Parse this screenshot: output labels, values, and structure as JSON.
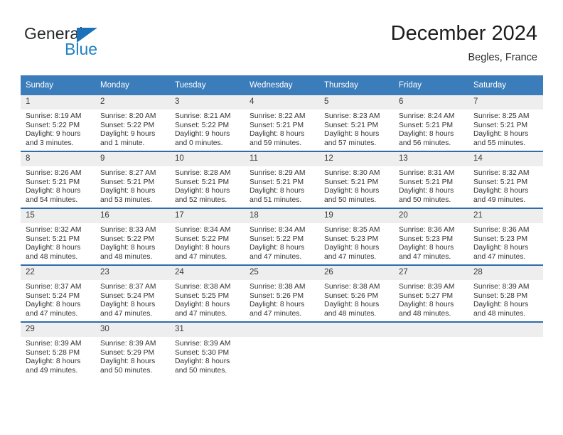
{
  "brand": {
    "name_part1": "General",
    "name_part2": "Blue",
    "triangle_color": "#1b72b8",
    "blue_color": "#2081c3"
  },
  "header": {
    "title": "December 2024",
    "location": "Begles, France"
  },
  "theme": {
    "header_blue": "#3b7cba",
    "row_border_blue": "#2f6caa",
    "daynum_band": "#eeeeee"
  },
  "calendar": {
    "weekday_headers": [
      "Sunday",
      "Monday",
      "Tuesday",
      "Wednesday",
      "Thursday",
      "Friday",
      "Saturday"
    ],
    "weeks": [
      [
        {
          "day": "1",
          "sunrise": "Sunrise: 8:19 AM",
          "sunset": "Sunset: 5:22 PM",
          "daylight1": "Daylight: 9 hours",
          "daylight2": "and 3 minutes."
        },
        {
          "day": "2",
          "sunrise": "Sunrise: 8:20 AM",
          "sunset": "Sunset: 5:22 PM",
          "daylight1": "Daylight: 9 hours",
          "daylight2": "and 1 minute."
        },
        {
          "day": "3",
          "sunrise": "Sunrise: 8:21 AM",
          "sunset": "Sunset: 5:22 PM",
          "daylight1": "Daylight: 9 hours",
          "daylight2": "and 0 minutes."
        },
        {
          "day": "4",
          "sunrise": "Sunrise: 8:22 AM",
          "sunset": "Sunset: 5:21 PM",
          "daylight1": "Daylight: 8 hours",
          "daylight2": "and 59 minutes."
        },
        {
          "day": "5",
          "sunrise": "Sunrise: 8:23 AM",
          "sunset": "Sunset: 5:21 PM",
          "daylight1": "Daylight: 8 hours",
          "daylight2": "and 57 minutes."
        },
        {
          "day": "6",
          "sunrise": "Sunrise: 8:24 AM",
          "sunset": "Sunset: 5:21 PM",
          "daylight1": "Daylight: 8 hours",
          "daylight2": "and 56 minutes."
        },
        {
          "day": "7",
          "sunrise": "Sunrise: 8:25 AM",
          "sunset": "Sunset: 5:21 PM",
          "daylight1": "Daylight: 8 hours",
          "daylight2": "and 55 minutes."
        }
      ],
      [
        {
          "day": "8",
          "sunrise": "Sunrise: 8:26 AM",
          "sunset": "Sunset: 5:21 PM",
          "daylight1": "Daylight: 8 hours",
          "daylight2": "and 54 minutes."
        },
        {
          "day": "9",
          "sunrise": "Sunrise: 8:27 AM",
          "sunset": "Sunset: 5:21 PM",
          "daylight1": "Daylight: 8 hours",
          "daylight2": "and 53 minutes."
        },
        {
          "day": "10",
          "sunrise": "Sunrise: 8:28 AM",
          "sunset": "Sunset: 5:21 PM",
          "daylight1": "Daylight: 8 hours",
          "daylight2": "and 52 minutes."
        },
        {
          "day": "11",
          "sunrise": "Sunrise: 8:29 AM",
          "sunset": "Sunset: 5:21 PM",
          "daylight1": "Daylight: 8 hours",
          "daylight2": "and 51 minutes."
        },
        {
          "day": "12",
          "sunrise": "Sunrise: 8:30 AM",
          "sunset": "Sunset: 5:21 PM",
          "daylight1": "Daylight: 8 hours",
          "daylight2": "and 50 minutes."
        },
        {
          "day": "13",
          "sunrise": "Sunrise: 8:31 AM",
          "sunset": "Sunset: 5:21 PM",
          "daylight1": "Daylight: 8 hours",
          "daylight2": "and 50 minutes."
        },
        {
          "day": "14",
          "sunrise": "Sunrise: 8:32 AM",
          "sunset": "Sunset: 5:21 PM",
          "daylight1": "Daylight: 8 hours",
          "daylight2": "and 49 minutes."
        }
      ],
      [
        {
          "day": "15",
          "sunrise": "Sunrise: 8:32 AM",
          "sunset": "Sunset: 5:21 PM",
          "daylight1": "Daylight: 8 hours",
          "daylight2": "and 48 minutes."
        },
        {
          "day": "16",
          "sunrise": "Sunrise: 8:33 AM",
          "sunset": "Sunset: 5:22 PM",
          "daylight1": "Daylight: 8 hours",
          "daylight2": "and 48 minutes."
        },
        {
          "day": "17",
          "sunrise": "Sunrise: 8:34 AM",
          "sunset": "Sunset: 5:22 PM",
          "daylight1": "Daylight: 8 hours",
          "daylight2": "and 47 minutes."
        },
        {
          "day": "18",
          "sunrise": "Sunrise: 8:34 AM",
          "sunset": "Sunset: 5:22 PM",
          "daylight1": "Daylight: 8 hours",
          "daylight2": "and 47 minutes."
        },
        {
          "day": "19",
          "sunrise": "Sunrise: 8:35 AM",
          "sunset": "Sunset: 5:23 PM",
          "daylight1": "Daylight: 8 hours",
          "daylight2": "and 47 minutes."
        },
        {
          "day": "20",
          "sunrise": "Sunrise: 8:36 AM",
          "sunset": "Sunset: 5:23 PM",
          "daylight1": "Daylight: 8 hours",
          "daylight2": "and 47 minutes."
        },
        {
          "day": "21",
          "sunrise": "Sunrise: 8:36 AM",
          "sunset": "Sunset: 5:23 PM",
          "daylight1": "Daylight: 8 hours",
          "daylight2": "and 47 minutes."
        }
      ],
      [
        {
          "day": "22",
          "sunrise": "Sunrise: 8:37 AM",
          "sunset": "Sunset: 5:24 PM",
          "daylight1": "Daylight: 8 hours",
          "daylight2": "and 47 minutes."
        },
        {
          "day": "23",
          "sunrise": "Sunrise: 8:37 AM",
          "sunset": "Sunset: 5:24 PM",
          "daylight1": "Daylight: 8 hours",
          "daylight2": "and 47 minutes."
        },
        {
          "day": "24",
          "sunrise": "Sunrise: 8:38 AM",
          "sunset": "Sunset: 5:25 PM",
          "daylight1": "Daylight: 8 hours",
          "daylight2": "and 47 minutes."
        },
        {
          "day": "25",
          "sunrise": "Sunrise: 8:38 AM",
          "sunset": "Sunset: 5:26 PM",
          "daylight1": "Daylight: 8 hours",
          "daylight2": "and 47 minutes."
        },
        {
          "day": "26",
          "sunrise": "Sunrise: 8:38 AM",
          "sunset": "Sunset: 5:26 PM",
          "daylight1": "Daylight: 8 hours",
          "daylight2": "and 48 minutes."
        },
        {
          "day": "27",
          "sunrise": "Sunrise: 8:39 AM",
          "sunset": "Sunset: 5:27 PM",
          "daylight1": "Daylight: 8 hours",
          "daylight2": "and 48 minutes."
        },
        {
          "day": "28",
          "sunrise": "Sunrise: 8:39 AM",
          "sunset": "Sunset: 5:28 PM",
          "daylight1": "Daylight: 8 hours",
          "daylight2": "and 48 minutes."
        }
      ],
      [
        {
          "day": "29",
          "sunrise": "Sunrise: 8:39 AM",
          "sunset": "Sunset: 5:28 PM",
          "daylight1": "Daylight: 8 hours",
          "daylight2": "and 49 minutes."
        },
        {
          "day": "30",
          "sunrise": "Sunrise: 8:39 AM",
          "sunset": "Sunset: 5:29 PM",
          "daylight1": "Daylight: 8 hours",
          "daylight2": "and 50 minutes."
        },
        {
          "day": "31",
          "sunrise": "Sunrise: 8:39 AM",
          "sunset": "Sunset: 5:30 PM",
          "daylight1": "Daylight: 8 hours",
          "daylight2": "and 50 minutes."
        },
        {
          "day": "",
          "sunrise": "",
          "sunset": "",
          "daylight1": "",
          "daylight2": ""
        },
        {
          "day": "",
          "sunrise": "",
          "sunset": "",
          "daylight1": "",
          "daylight2": ""
        },
        {
          "day": "",
          "sunrise": "",
          "sunset": "",
          "daylight1": "",
          "daylight2": ""
        },
        {
          "day": "",
          "sunrise": "",
          "sunset": "",
          "daylight1": "",
          "daylight2": ""
        }
      ]
    ]
  }
}
